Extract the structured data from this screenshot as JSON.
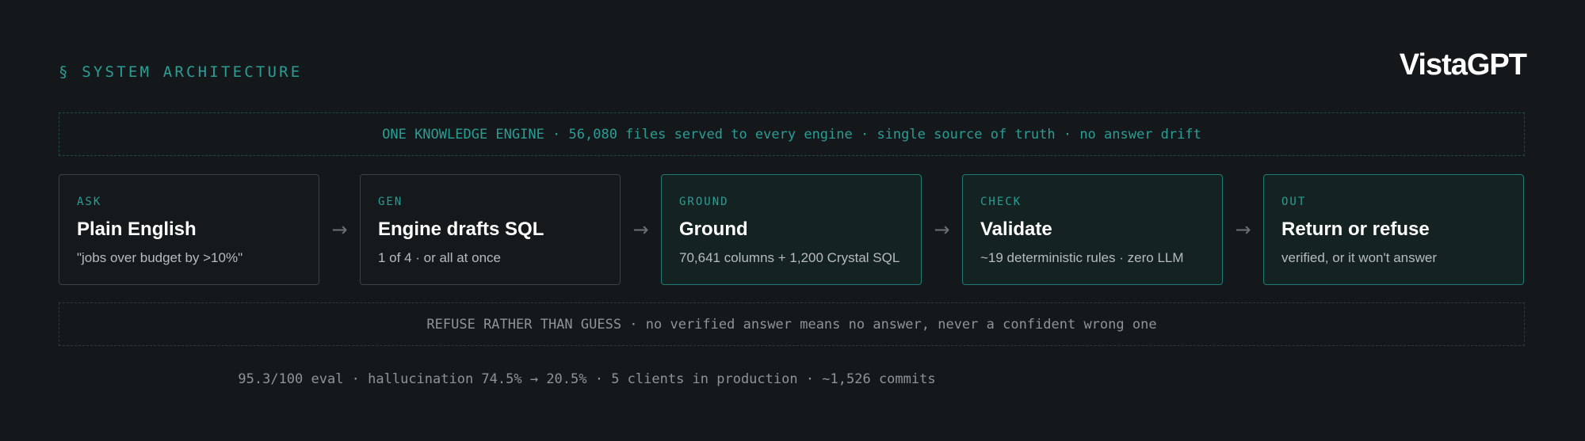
{
  "header": {
    "section_label": "§ SYSTEM ARCHITECTURE",
    "brand": "VistaGPT"
  },
  "top_banner": {
    "text": "ONE KNOWLEDGE ENGINE · 56,080 files served to every engine · single source of truth · no answer drift"
  },
  "arrow_glyph": "→",
  "steps": [
    {
      "tag": "ASK",
      "title": "Plain English",
      "desc": "\"jobs over budget by >10%\"",
      "highlight": false
    },
    {
      "tag": "GEN",
      "title": "Engine drafts SQL",
      "desc": "1 of 4 · or all at once",
      "highlight": false
    },
    {
      "tag": "GROUND",
      "title": "Ground",
      "desc": "70,641 columns + 1,200 Crystal SQL",
      "highlight": true
    },
    {
      "tag": "CHECK",
      "title": "Validate",
      "desc": "~19 deterministic rules · zero LLM",
      "highlight": true
    },
    {
      "tag": "OUT",
      "title": "Return or refuse",
      "desc": "verified, or it won't answer",
      "highlight": true
    }
  ],
  "bottom_banner": {
    "text": "REFUSE RATHER THAN GUESS · no verified answer means no answer, never a confident wrong one"
  },
  "stats": {
    "text": "95.3/100 eval · hallucination 74.5% → 20.5% · 5 clients in production · ~1,526 commits"
  },
  "colors": {
    "background": "#14181b",
    "accent": "#2a9d95",
    "highlight_border": "#1f7a73",
    "muted_text": "#8f9397"
  }
}
